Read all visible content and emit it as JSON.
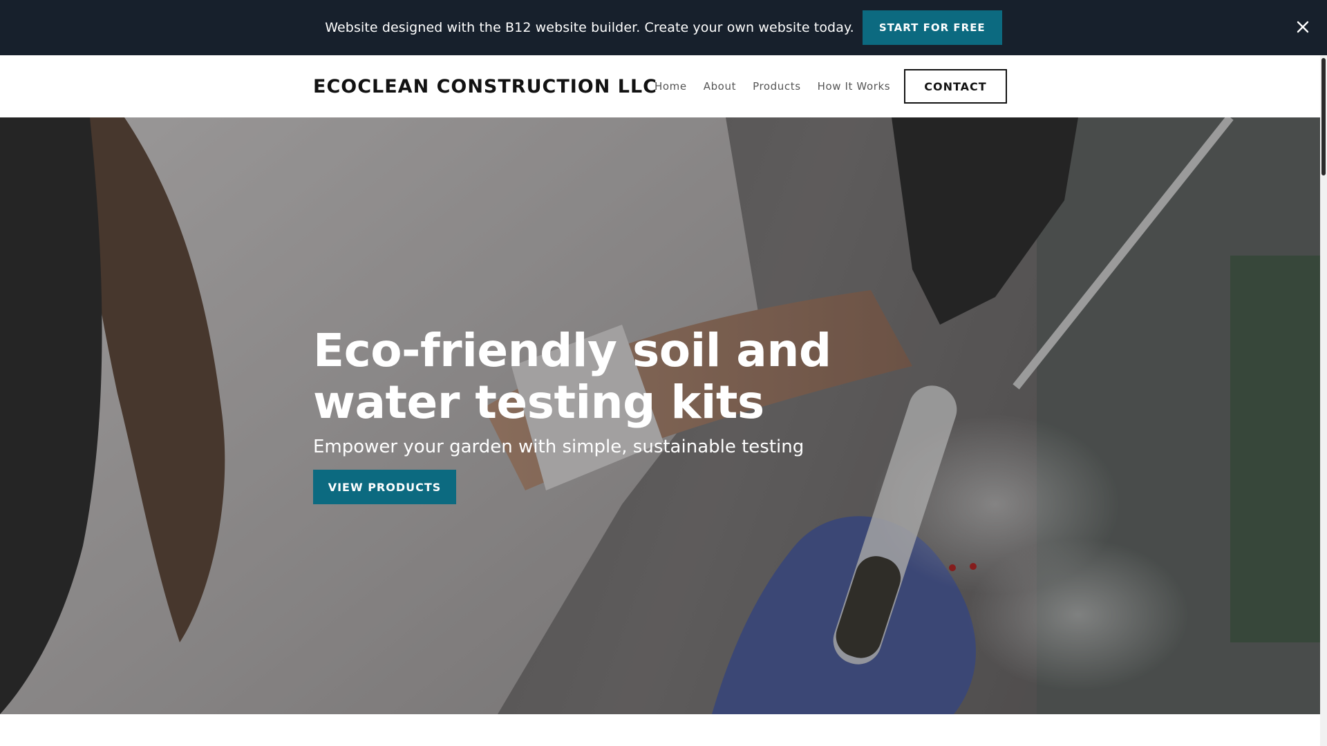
{
  "banner": {
    "text": "Website designed with the B12 website builder. Create your own website today.",
    "cta_label": "START FOR FREE",
    "close_icon": "close-icon"
  },
  "nav": {
    "brand": "ECOCLEAN CONSTRUCTION LLC",
    "links": [
      "Home",
      "About",
      "Products",
      "How It Works"
    ],
    "contact_label": "CONTACT"
  },
  "hero": {
    "title": "Eco-friendly soil and water testing kits",
    "subtitle": "Empower your garden with simple, sustainable testing",
    "cta_label": "VIEW PRODUCTS",
    "image": "scientist-holding-soil-test-tube-photo"
  },
  "colors": {
    "banner_bg": "#17202c",
    "accent": "#0c6a80",
    "brand_text": "#121212"
  }
}
